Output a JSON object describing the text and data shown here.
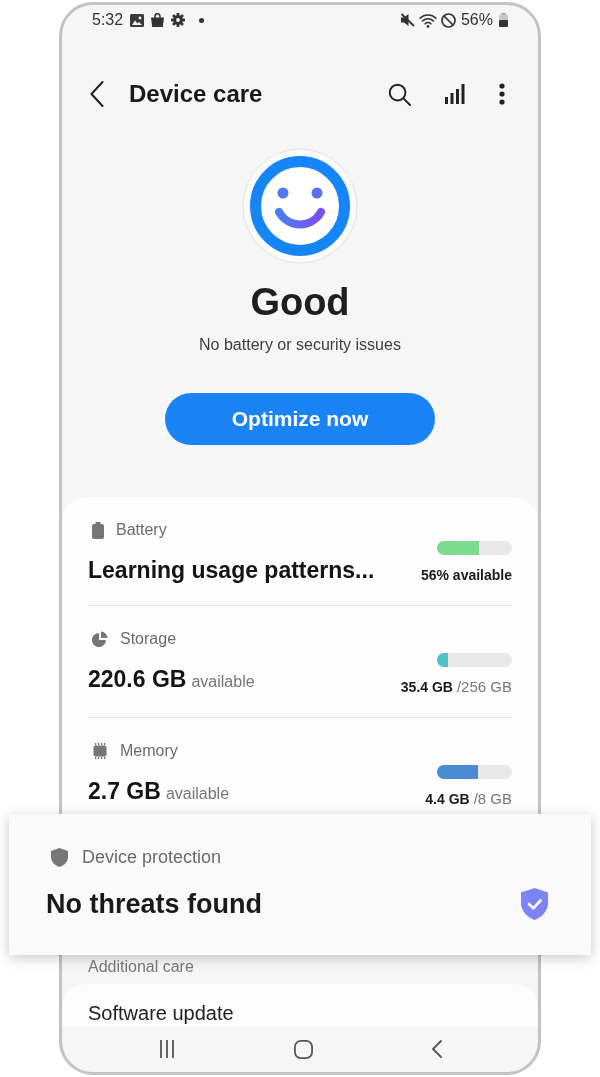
{
  "status_bar": {
    "time": "5:32",
    "battery": "56%"
  },
  "header": {
    "title": "Device care"
  },
  "overview": {
    "heading": "Good",
    "subtitle": "No battery or security issues",
    "action": "Optimize now"
  },
  "resources": [
    {
      "kind": "battery",
      "label": "Battery",
      "value": "Learning usage patterns...",
      "level": 0.56,
      "color": "#7ddb8f",
      "reading": "56% available"
    },
    {
      "kind": "storage",
      "label": "Storage",
      "value": "220.6 GB",
      "unit": "available",
      "level": 0.14,
      "color": "#4cc3c6",
      "used": "35.4 GB",
      "total": "/256 GB"
    },
    {
      "kind": "memory",
      "label": "Memory",
      "value": "2.7 GB",
      "unit": "available",
      "level": 0.55,
      "color": "#4a8bd4",
      "used": "4.4 GB",
      "total": "/8 GB"
    }
  ],
  "protection": {
    "label": "Device protection",
    "status": "No threats found"
  },
  "additional_care": {
    "heading": "Additional care",
    "items": [
      "Software update"
    ]
  }
}
